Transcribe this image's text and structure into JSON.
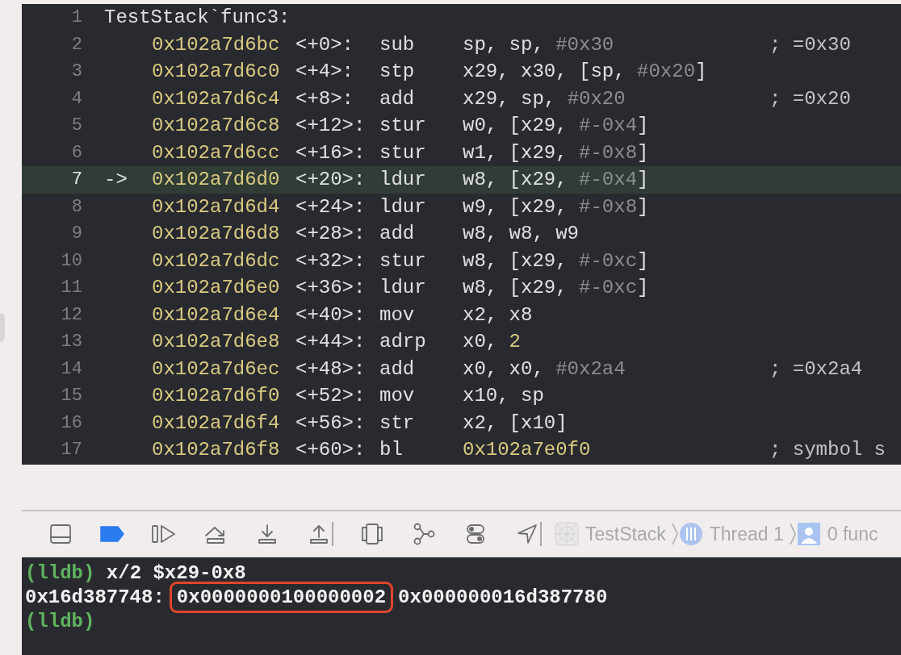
{
  "disassembly": {
    "rows": [
      {
        "kind": "label",
        "line": "1",
        "text": "TestStack`func3:",
        "current": false
      },
      {
        "kind": "instruction",
        "line": "2",
        "address": "0x102a7d6bc",
        "offset": "<+0>:",
        "mnemonic": "sub",
        "operands": [
          {
            "kind": "reg",
            "text": "sp, sp, "
          },
          {
            "kind": "imm",
            "text": "#0x30"
          }
        ],
        "comment": "; =0x30",
        "current": false
      },
      {
        "kind": "instruction",
        "line": "3",
        "address": "0x102a7d6c0",
        "offset": "<+4>:",
        "mnemonic": "stp",
        "operands": [
          {
            "kind": "reg",
            "text": "x29, x30, [sp, "
          },
          {
            "kind": "imm",
            "text": "#0x20"
          },
          {
            "kind": "reg",
            "text": "]"
          }
        ],
        "current": false
      },
      {
        "kind": "instruction",
        "line": "4",
        "address": "0x102a7d6c4",
        "offset": "<+8>:",
        "mnemonic": "add",
        "operands": [
          {
            "kind": "reg",
            "text": "x29, sp, "
          },
          {
            "kind": "imm",
            "text": "#0x20"
          }
        ],
        "comment": "; =0x20",
        "current": false
      },
      {
        "kind": "instruction",
        "line": "5",
        "address": "0x102a7d6c8",
        "offset": "<+12>:",
        "mnemonic": "stur",
        "operands": [
          {
            "kind": "reg",
            "text": "w0, [x29, "
          },
          {
            "kind": "imm",
            "text": "#-0x4"
          },
          {
            "kind": "reg",
            "text": "]"
          }
        ],
        "current": false
      },
      {
        "kind": "instruction",
        "line": "6",
        "address": "0x102a7d6cc",
        "offset": "<+16>:",
        "mnemonic": "stur",
        "operands": [
          {
            "kind": "reg",
            "text": "w1, [x29, "
          },
          {
            "kind": "imm",
            "text": "#-0x8"
          },
          {
            "kind": "reg",
            "text": "]"
          }
        ],
        "current": false
      },
      {
        "kind": "instruction",
        "line": "7",
        "arrow": "->",
        "address": "0x102a7d6d0",
        "offset": "<+20>:",
        "mnemonic": "ldur",
        "operands": [
          {
            "kind": "reg",
            "text": "w8, [x29, "
          },
          {
            "kind": "imm",
            "text": "#-0x4"
          },
          {
            "kind": "reg",
            "text": "]"
          }
        ],
        "current": true
      },
      {
        "kind": "instruction",
        "line": "8",
        "address": "0x102a7d6d4",
        "offset": "<+24>:",
        "mnemonic": "ldur",
        "operands": [
          {
            "kind": "reg",
            "text": "w9, [x29, "
          },
          {
            "kind": "imm",
            "text": "#-0x8"
          },
          {
            "kind": "reg",
            "text": "]"
          }
        ],
        "current": false
      },
      {
        "kind": "instruction",
        "line": "9",
        "address": "0x102a7d6d8",
        "offset": "<+28>:",
        "mnemonic": "add",
        "operands": [
          {
            "kind": "reg",
            "text": "w8, w8, w9"
          }
        ],
        "current": false
      },
      {
        "kind": "instruction",
        "line": "10",
        "address": "0x102a7d6dc",
        "offset": "<+32>:",
        "mnemonic": "stur",
        "operands": [
          {
            "kind": "reg",
            "text": "w8, [x29, "
          },
          {
            "kind": "imm",
            "text": "#-0xc"
          },
          {
            "kind": "reg",
            "text": "]"
          }
        ],
        "current": false
      },
      {
        "kind": "instruction",
        "line": "11",
        "address": "0x102a7d6e0",
        "offset": "<+36>:",
        "mnemonic": "ldur",
        "operands": [
          {
            "kind": "reg",
            "text": "w8, [x29, "
          },
          {
            "kind": "imm",
            "text": "#-0xc"
          },
          {
            "kind": "reg",
            "text": "]"
          }
        ],
        "current": false
      },
      {
        "kind": "instruction",
        "line": "12",
        "address": "0x102a7d6e4",
        "offset": "<+40>:",
        "mnemonic": "mov",
        "operands": [
          {
            "kind": "reg",
            "text": "x2, x8"
          }
        ],
        "current": false
      },
      {
        "kind": "instruction",
        "line": "13",
        "address": "0x102a7d6e8",
        "offset": "<+44>:",
        "mnemonic": "adrp",
        "operands": [
          {
            "kind": "reg",
            "text": "x0, "
          },
          {
            "kind": "num",
            "text": "2"
          }
        ],
        "current": false
      },
      {
        "kind": "instruction",
        "line": "14",
        "address": "0x102a7d6ec",
        "offset": "<+48>:",
        "mnemonic": "add",
        "operands": [
          {
            "kind": "reg",
            "text": "x0, x0, "
          },
          {
            "kind": "imm",
            "text": "#0x2a4"
          }
        ],
        "comment": "; =0x2a4",
        "current": false
      },
      {
        "kind": "instruction",
        "line": "15",
        "address": "0x102a7d6f0",
        "offset": "<+52>:",
        "mnemonic": "mov",
        "operands": [
          {
            "kind": "reg",
            "text": "x10, sp"
          }
        ],
        "current": false
      },
      {
        "kind": "instruction",
        "line": "16",
        "address": "0x102a7d6f4",
        "offset": "<+56>:",
        "mnemonic": "str",
        "operands": [
          {
            "kind": "reg",
            "text": "x2, [x10]"
          }
        ],
        "current": false
      },
      {
        "kind": "instruction",
        "line": "17",
        "address": "0x102a7d6f8",
        "offset": "<+60>:",
        "mnemonic": "bl",
        "operands": [
          {
            "kind": "num",
            "text": "0x102a7e0f0"
          }
        ],
        "comment": "; symbol s",
        "current": false
      }
    ]
  },
  "debug_bar": {
    "breakpoints_active": true,
    "breadcrumbs": [
      {
        "kind": "app",
        "label": "TestStack"
      },
      {
        "kind": "thread",
        "label": "Thread 1"
      },
      {
        "kind": "frame",
        "label": "0 func"
      }
    ]
  },
  "console": {
    "lines": [
      {
        "kind": "command",
        "prompt": "(lldb)",
        "command": "x/2 $x29-0x8"
      },
      {
        "kind": "output",
        "address": "0x16d387748:",
        "values": [
          {
            "text": "0x0000000100000002",
            "highlighted": true
          },
          {
            "text": "0x000000016d387780",
            "highlighted": false
          }
        ]
      },
      {
        "kind": "command",
        "prompt": "(lldb)"
      }
    ]
  }
}
